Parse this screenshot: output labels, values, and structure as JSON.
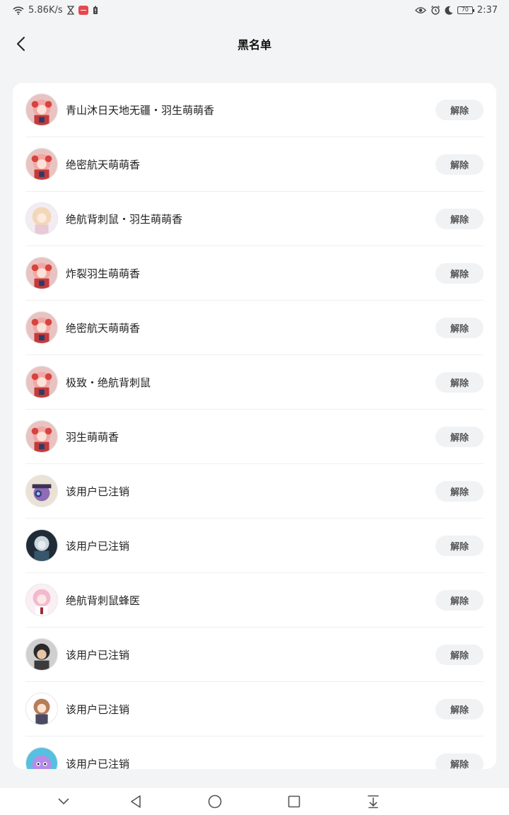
{
  "status_bar": {
    "speed": "5.86K/s",
    "battery": "70",
    "time": "2:37"
  },
  "header": {
    "title": "黑名单"
  },
  "unblock_label": "解除",
  "users": [
    {
      "name": "青山沐日天地无疆・羽生萌萌香",
      "avatar_theme": "red-pink-girl"
    },
    {
      "name": "绝密航天萌萌香",
      "avatar_theme": "red-pink-girl"
    },
    {
      "name": "绝航背刺鼠・羽生萌萌香",
      "avatar_theme": "light-blonde-girl"
    },
    {
      "name": "炸裂羽生萌萌香",
      "avatar_theme": "red-pink-girl"
    },
    {
      "name": "绝密航天萌萌香",
      "avatar_theme": "red-pink-girl"
    },
    {
      "name": "极致・绝航背刺鼠",
      "avatar_theme": "red-pink-girl"
    },
    {
      "name": "羽生萌萌香",
      "avatar_theme": "red-pink-girl"
    },
    {
      "name": "该用户已注销",
      "avatar_theme": "purple-hat-character"
    },
    {
      "name": "该用户已注销",
      "avatar_theme": "dark-blue-character"
    },
    {
      "name": "绝航背刺鼠蜂医",
      "avatar_theme": "pink-hair-girl"
    },
    {
      "name": "该用户已注销",
      "avatar_theme": "dark-hair-man"
    },
    {
      "name": "该用户已注销",
      "avatar_theme": "brown-hair-girl"
    },
    {
      "name": "该用户已注销",
      "avatar_theme": "purple-creature"
    }
  ],
  "colors": {
    "background": "#f3f4f6",
    "card": "#ffffff",
    "button_bg": "#f1f2f4",
    "button_text": "#555555"
  }
}
